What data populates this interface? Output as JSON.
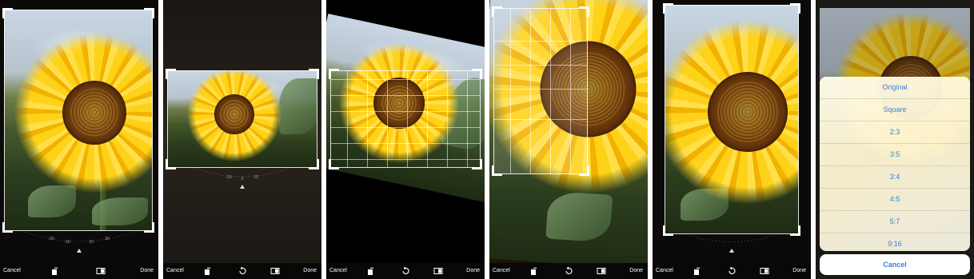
{
  "toolbar": {
    "cancel_label": "Cancel",
    "done_label": "Done"
  },
  "dial": {
    "ticks": [
      "-20",
      "-10",
      "0",
      "10",
      "20"
    ]
  },
  "aspect_sheet": {
    "options": [
      "Original",
      "Square",
      "2:3",
      "3:5",
      "3:4",
      "4:5",
      "5:7",
      "9:16"
    ],
    "cancel_label": "Cancel"
  },
  "icons": {
    "rotate": "rotate-icon",
    "aspect": "aspect-ratio-icon",
    "reset_rotation": "rotate-counterclockwise-icon"
  }
}
